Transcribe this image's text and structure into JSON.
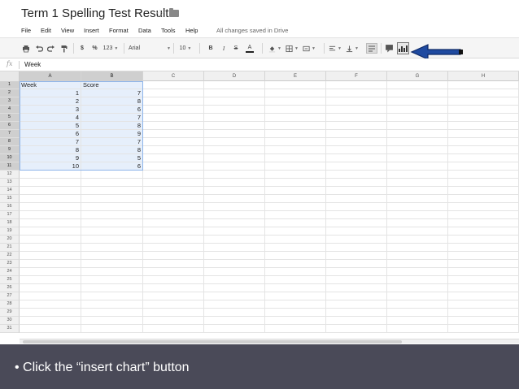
{
  "document": {
    "title": "Term 1 Spelling Test Results",
    "save_status": "All changes saved in Drive"
  },
  "menu": [
    "File",
    "Edit",
    "View",
    "Insert",
    "Format",
    "Data",
    "Tools",
    "Help"
  ],
  "toolbar": {
    "currency": "$",
    "percent": "%",
    "number_format": "123",
    "font": "Arial",
    "font_size": "10",
    "bold": "B",
    "italic": "I",
    "strike": "S",
    "text_color": "A"
  },
  "formula_bar": {
    "fx": "fx",
    "value": "Week"
  },
  "columns": [
    "A",
    "B",
    "C",
    "D",
    "E",
    "F",
    "G",
    "H"
  ],
  "rows": [
    "1",
    "2",
    "3",
    "4",
    "5",
    "6",
    "7",
    "8",
    "9",
    "10",
    "11",
    "12",
    "13",
    "14",
    "15",
    "16",
    "17",
    "18",
    "19",
    "20",
    "21",
    "22",
    "23",
    "24",
    "25",
    "26",
    "27",
    "28",
    "29",
    "30",
    "31"
  ],
  "table": {
    "headers": [
      "Week",
      "Score"
    ],
    "rows": [
      [
        "1",
        "7"
      ],
      [
        "2",
        "8"
      ],
      [
        "3",
        "6"
      ],
      [
        "4",
        "7"
      ],
      [
        "5",
        "8"
      ],
      [
        "6",
        "9"
      ],
      [
        "7",
        "7"
      ],
      [
        "8",
        "8"
      ],
      [
        "9",
        "5"
      ],
      [
        "10",
        "6"
      ]
    ]
  },
  "icons": {
    "print": "printer-icon",
    "undo": "undo-icon",
    "redo": "redo-icon",
    "paint_format": "paint-format-icon",
    "insert_chart": "insert-chart-icon",
    "arrow": "arrow-left-icon"
  },
  "colors": {
    "selection_fill": "#e6effb",
    "selection_border": "#8fb5ea",
    "arrow": "#1f4aa0",
    "caption_bar": "#4a4a58"
  },
  "caption": "• Click the “insert chart” button"
}
